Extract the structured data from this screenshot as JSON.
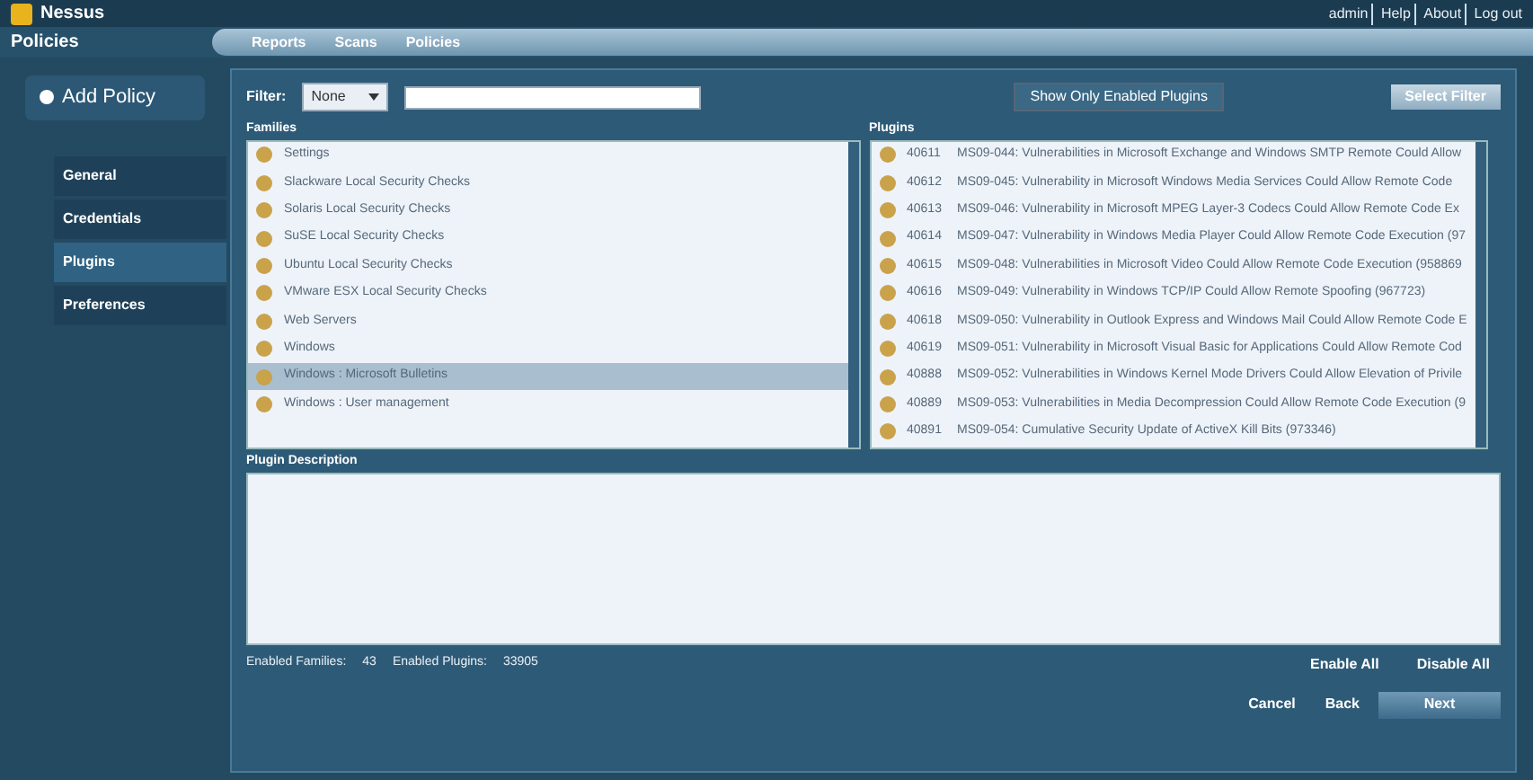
{
  "app": {
    "name": "Nessus",
    "user_links": [
      "admin",
      "Help",
      "About",
      "Log out"
    ]
  },
  "section_title": "Policies",
  "tabs": [
    {
      "label": "Reports",
      "selected": false
    },
    {
      "label": "Scans",
      "selected": false
    },
    {
      "label": "Policies",
      "selected": false
    }
  ],
  "add_policy": "Add Policy",
  "nav": [
    {
      "label": "General",
      "selected": false
    },
    {
      "label": "Credentials",
      "selected": false
    },
    {
      "label": "Plugins",
      "selected": true
    },
    {
      "label": "Preferences",
      "selected": false
    }
  ],
  "filter": {
    "label": "Filter:",
    "select": "None",
    "show_enabled": "Show Only Enabled Plugins",
    "button": "Select Filter"
  },
  "families": {
    "title": "Families",
    "items": [
      {
        "label": "Settings",
        "selected": false
      },
      {
        "label": "Slackware Local Security Checks",
        "selected": false
      },
      {
        "label": "Solaris Local Security Checks",
        "selected": false
      },
      {
        "label": "SuSE Local Security Checks",
        "selected": false
      },
      {
        "label": "Ubuntu Local Security Checks",
        "selected": false
      },
      {
        "label": "VMware ESX Local Security Checks",
        "selected": false
      },
      {
        "label": "Web Servers",
        "selected": false
      },
      {
        "label": "Windows",
        "selected": false
      },
      {
        "label": "Windows : Microsoft Bulletins",
        "selected": true
      },
      {
        "label": "Windows : User management",
        "selected": false
      }
    ]
  },
  "plugins": {
    "title": "Plugins",
    "items": [
      {
        "id": "40611",
        "name": "MS09-044: Vulnerabilities in Microsoft Exchange and Windows SMTP Remote Could Allow"
      },
      {
        "id": "40612",
        "name": "MS09-045: Vulnerability in Microsoft Windows Media Services Could Allow Remote Code"
      },
      {
        "id": "40613",
        "name": "MS09-046: Vulnerability in Microsoft MPEG Layer-3 Codecs Could Allow Remote Code Ex"
      },
      {
        "id": "40614",
        "name": "MS09-047: Vulnerability in Windows Media Player Could Allow Remote Code Execution (97"
      },
      {
        "id": "40615",
        "name": "MS09-048: Vulnerabilities in Microsoft Video Could Allow Remote Code Execution (958869"
      },
      {
        "id": "40616",
        "name": "MS09-049: Vulnerability in Windows TCP/IP Could Allow Remote Spoofing (967723)"
      },
      {
        "id": "40618",
        "name": "MS09-050: Vulnerability in Outlook Express and Windows Mail Could Allow Remote Code E"
      },
      {
        "id": "40619",
        "name": "MS09-051: Vulnerability in Microsoft Visual Basic for Applications Could Allow Remote Cod"
      },
      {
        "id": "40888",
        "name": "MS09-052: Vulnerabilities in Windows Kernel Mode Drivers Could Allow Elevation of Privile"
      },
      {
        "id": "40889",
        "name": "MS09-053: Vulnerabilities in Media Decompression Could Allow Remote Code Execution (9"
      },
      {
        "id": "40891",
        "name": "MS09-054: Cumulative Security Update of ActiveX Kill Bits (973346)"
      }
    ]
  },
  "description": {
    "title": "Plugin Description"
  },
  "status": {
    "families_label": "Enabled Families:",
    "families_count": "43",
    "plugins_label": "Enabled Plugins:",
    "plugins_count": "33905"
  },
  "list_actions": [
    "Enable All",
    "Disable All"
  ],
  "footer_buttons": [
    {
      "label": "Cancel",
      "kind": "link"
    },
    {
      "label": "Back",
      "kind": "link"
    },
    {
      "label": "Next",
      "kind": "primary"
    }
  ]
}
